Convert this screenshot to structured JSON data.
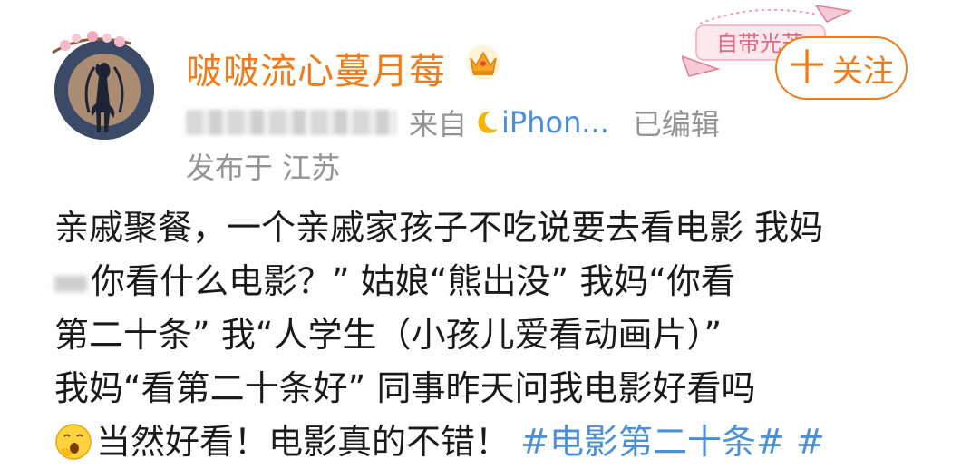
{
  "user": {
    "name": "啵啵流心蔓月莓",
    "from_label": "来自",
    "device": "iPhon...",
    "edited_label": "已编辑",
    "location": "发布于 江苏"
  },
  "follow_button": {
    "plus": "十",
    "label": "关注"
  },
  "badge_text": "自带光芒",
  "post": {
    "line1": "亲戚聚餐，一个亲戚家孩子不吃说要去看电影 我妈",
    "line2": "你看什么电影？”  姑娘“熊出没” 我妈“你看",
    "line3": "第二十条” 我“人学生（小孩儿爱看动画片）”",
    "line4": "我妈“看第二十条好”  同事昨天问我电影好看吗",
    "line5_text": "当然好看！电影真的不错！",
    "hashtag": "#电影第二十条#",
    "hashtag2": "#"
  },
  "colors": {
    "username": "#f07b18",
    "link": "#4a8fd8",
    "meta": "#939393"
  }
}
